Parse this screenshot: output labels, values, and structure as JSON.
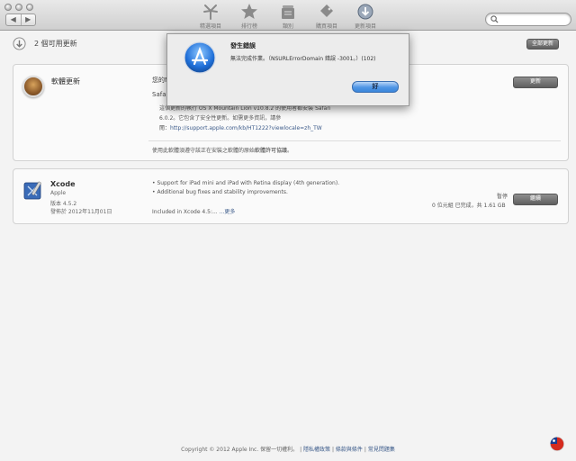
{
  "toolbar": {
    "nav": {
      "back": "◀",
      "forward": "▶"
    },
    "tabs": [
      {
        "label": "精選項目",
        "icon": "featured-icon"
      },
      {
        "label": "排行榜",
        "icon": "star-icon"
      },
      {
        "label": "類別",
        "icon": "categories-icon"
      },
      {
        "label": "購買項目",
        "icon": "purchases-icon"
      },
      {
        "label": "更新項目",
        "icon": "updates-icon",
        "badge": "2"
      }
    ],
    "search": {
      "placeholder": ""
    }
  },
  "header": {
    "count_label": "2 個可用更新",
    "update_all_label": "全部更新"
  },
  "software_update": {
    "title": "軟體更新",
    "update_button": "更新",
    "intro": "您的Mac有可用的軟體更新",
    "item_name": "Safari 6.0.2",
    "description_line1": "這個更新的執行 OS X Mountain Lion v10.8.2 的使用者都安裝 Safari",
    "description_line2": "6.0.2。它包含了安全性更新。如需更多資訊，請參",
    "description_line3_prefix": "閱：",
    "link": "http://support.apple.com/kb/HT1222?viewlocale=zh_TW",
    "license_prefix": "使用此軟體須遵守該正在安裝之軟體的原始",
    "license_link": "軟體許可協議",
    "license_suffix": "。"
  },
  "xcode": {
    "name": "Xcode",
    "publisher": "Apple",
    "version": "版本 4.5.2",
    "released": "發佈於 2012年11月01日",
    "notes": [
      "• Support for iPad mini and iPad with Retina display (4th generation).",
      "• Additional bug fixes and stability improvements."
    ],
    "included_prefix": "Included in Xcode 4.5:... ",
    "more_link": "...更多",
    "status": "暫停",
    "progress_text": "0 位元組 已完成，共 1.61 GB",
    "resume_button": "繼續"
  },
  "dialog": {
    "title": "發生錯誤",
    "message": "無法完成作業。（NSURLErrorDomain 錯誤 -3001。）(102)",
    "ok_label": "好"
  },
  "footer": {
    "copyright": "Copyright © 2012 Apple Inc. 保留一切權利。",
    "privacy": "隱私權政策",
    "terms": "條款與條件",
    "faq": "常見問題集",
    "separator": "|"
  }
}
